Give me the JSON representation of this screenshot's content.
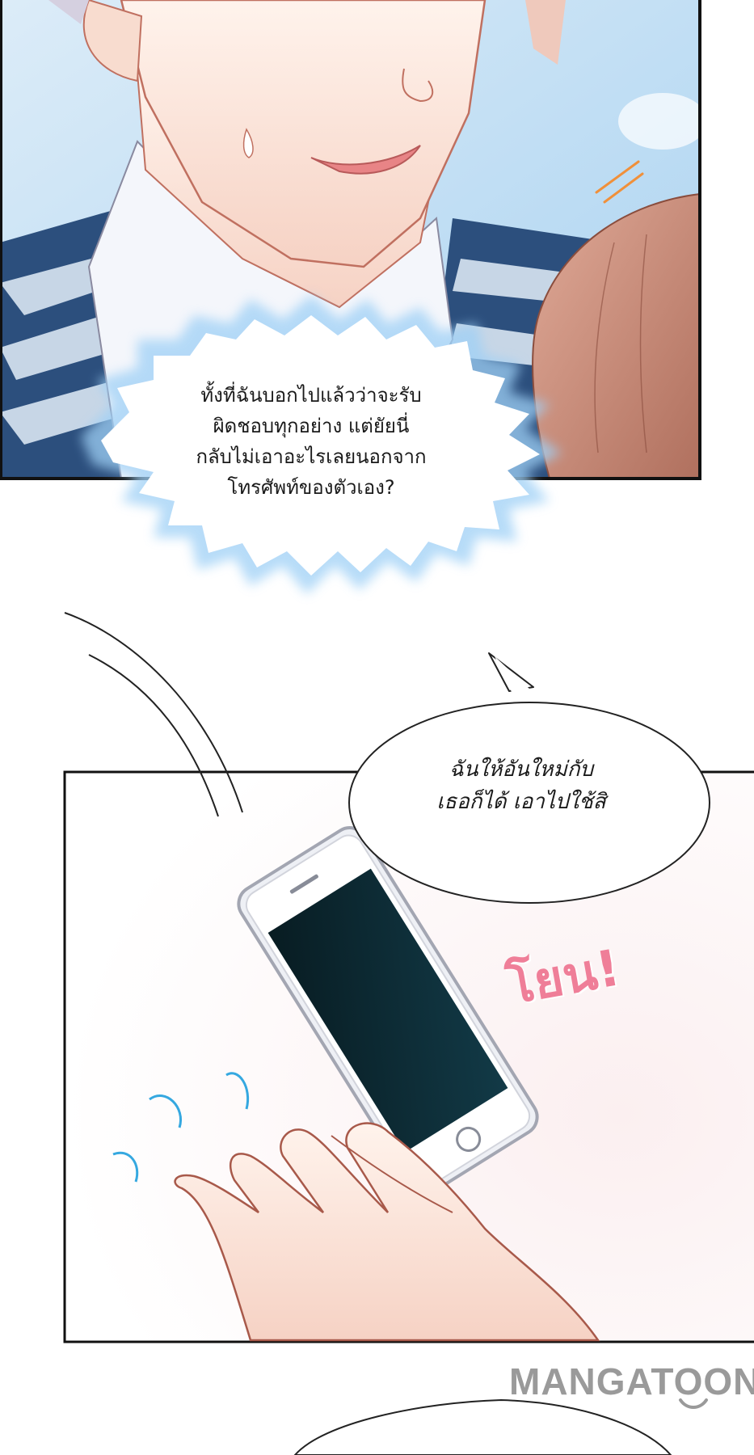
{
  "panel_top": {
    "burst_bubble": {
      "lines": [
        "ทั้งที่ฉันบอกไปแล้วว่าจะรับ",
        "ผิดชอบทุกอย่าง แต่ยัยนี่",
        "กลับไม่เอาอะไรเลยนอกจาก",
        "โทรศัพท์ของตัวเอง?"
      ]
    }
  },
  "panel_bottom": {
    "speech_bubble": {
      "lines": [
        "ฉันให้อันใหม่กับ",
        "เธอก็ได้ เอาไปใช้สิ"
      ]
    },
    "sfx": "โยน!"
  },
  "watermark": "MANGATOON",
  "colors": {
    "sky": "#cfe6f7",
    "skin": "#fbe6da",
    "hair_brown": "#c98a76",
    "sfx_pink": "#ef7e98",
    "burst_glow": "#9fd0f6",
    "motion_blue": "#35a8e0",
    "phone_screen": "#0d2a33",
    "watermark_gray": "#9a9a9a"
  }
}
